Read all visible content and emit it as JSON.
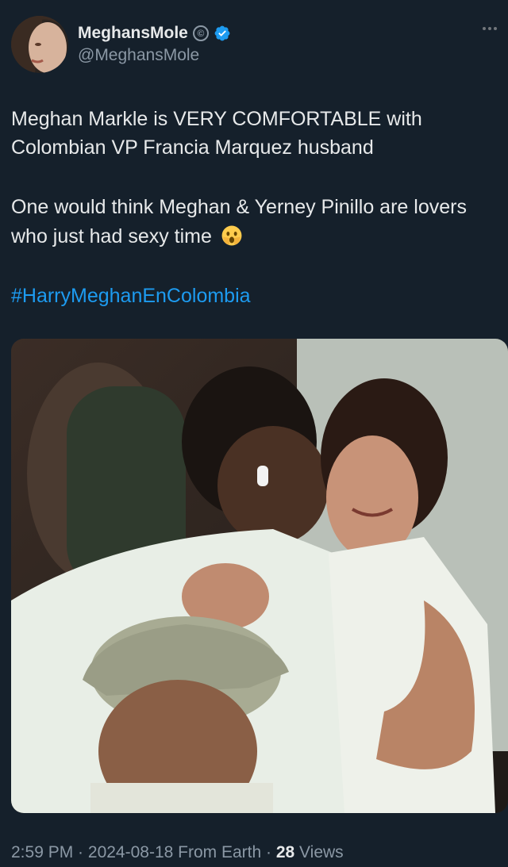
{
  "author": {
    "display_name": "MeghansMole",
    "handle": "@MeghansMole",
    "copyright_symbol": "©"
  },
  "tweet": {
    "line1": "Meghan Markle is VERY COMFORTABLE with",
    "line2": "Colombian VP Francia Marquez husband",
    "line3": "One would think Meghan & Yerney Pinillo are lovers",
    "line4": "who just had sexy time",
    "hashtag": "#HarryMeghanEnColombia"
  },
  "meta": {
    "time": "2:59 PM",
    "sep1": " · ",
    "date": "2024-08-18",
    "source": " From Earth",
    "sep2": " · ",
    "views_count": "28",
    "views_label": " Views"
  },
  "colors": {
    "background": "#15202b",
    "link": "#1d9bf0",
    "verified": "#1d9bf0",
    "secondary_text": "#8b98a5"
  }
}
